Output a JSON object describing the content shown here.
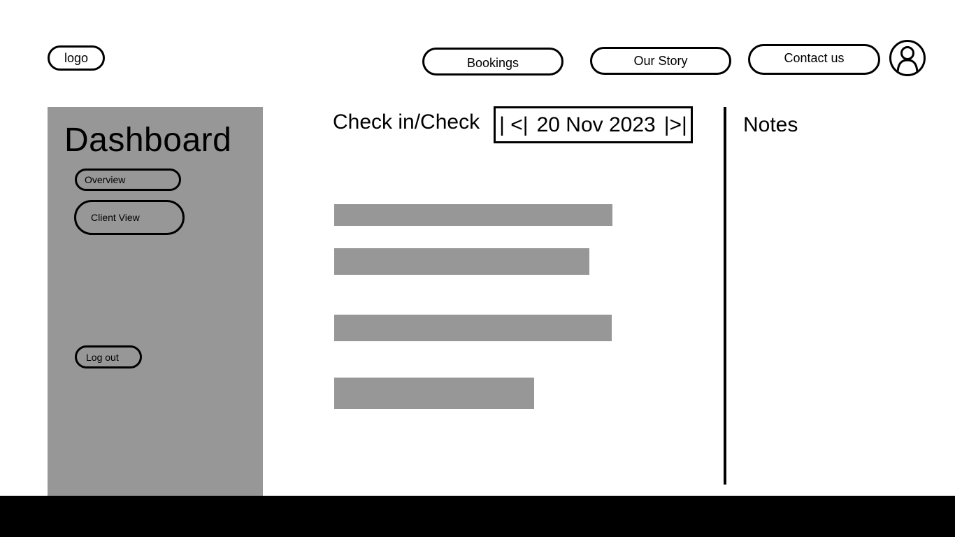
{
  "header": {
    "logo_label": "logo",
    "nav": {
      "bookings": "Bookings",
      "our_story": "Our Story",
      "contact": "Contact us"
    },
    "avatar_icon": "user-profile-icon"
  },
  "sidebar": {
    "title": "Dashboard",
    "items": [
      {
        "label": "Overview"
      },
      {
        "label": "Client View"
      }
    ],
    "logout_label": "Log out",
    "background": "#979797"
  },
  "main": {
    "checkin_label": "Check in/Check",
    "date_nav": {
      "prev": "| <|",
      "date": "20 Nov 2023",
      "next": "|>|"
    },
    "placeholder_color": "#979797"
  },
  "notes": {
    "title": "Notes"
  }
}
